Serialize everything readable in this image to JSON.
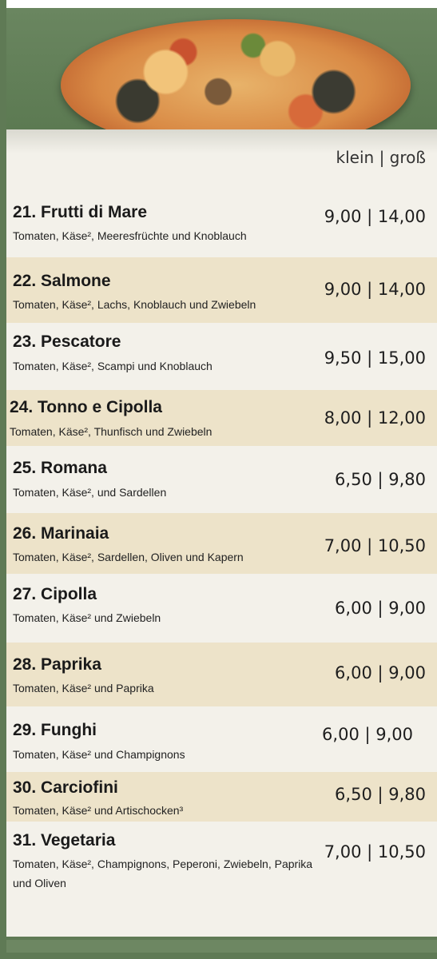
{
  "size_header": "klein | groß",
  "items": [
    {
      "name": "21. Frutti di Mare",
      "desc": "Tomaten, Käse², Meeresfrüchte und Knoblauch",
      "price": "9,00 | 14,00"
    },
    {
      "name": "22. Salmone",
      "desc": "Tomaten, Käse², Lachs, Knoblauch und Zwiebeln",
      "price": "9,00 | 14,00"
    },
    {
      "name": "23. Pescatore",
      "desc": "Tomaten, Käse², Scampi und Knoblauch",
      "price": "9,50 | 15,00"
    },
    {
      "name": "24. Tonno e Cipolla",
      "desc": "Tomaten, Käse², Thunfisch und Zwiebeln",
      "price": "8,00 | 12,00"
    },
    {
      "name": "25. Romana",
      "desc": "Tomaten, Käse², und Sardellen",
      "price": "6,50 | 9,80"
    },
    {
      "name": "26. Marinaia",
      "desc": "Tomaten, Käse², Sardellen, Oliven und Kapern",
      "price": "7,00 | 10,50"
    },
    {
      "name": "27. Cipolla",
      "desc": "Tomaten, Käse² und Zwiebeln",
      "price": "6,00 | 9,00"
    },
    {
      "name": "28. Paprika",
      "desc": "Tomaten, Käse² und Paprika",
      "price": "6,00 | 9,00"
    },
    {
      "name": "29. Funghi",
      "desc": "Tomaten, Käse² und Champignons",
      "price": "6,00 | 9,00"
    },
    {
      "name": "30. Carciofini",
      "desc": "Tomaten, Käse² und Artischocken³",
      "price": "6,50 | 9,80"
    },
    {
      "name": "31. Vegetaria",
      "desc": "Tomaten, Käse², Champignons, Peperoni, Zwiebeln, Paprika und Oliven",
      "price": "7,00 | 10,50"
    }
  ]
}
